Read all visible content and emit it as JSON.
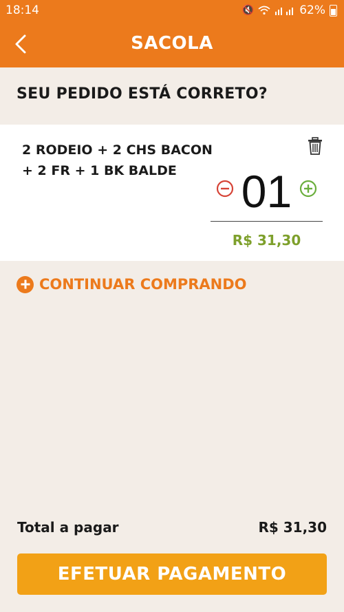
{
  "status_bar": {
    "time": "18:14",
    "battery": "62%"
  },
  "app_bar": {
    "title": "SACOLA"
  },
  "question": "SEU PEDIDO ESTÁ CORRETO?",
  "item": {
    "name_line1": "2 RODEIO + 2 CHS BACON",
    "name_line2": "+ 2 FR + 1 BK BALDE",
    "quantity": "01",
    "price": "R$ 31,30"
  },
  "continue_label": "CONTINUAR COMPRANDO",
  "total": {
    "label": "Total a pagar",
    "value": "R$ 31,30"
  },
  "pay_button_label": "EFETUAR PAGAMENTO",
  "colors": {
    "brand_orange": "#ec7a1c",
    "button_yellow": "#f2a116",
    "price_green": "#7ea02c",
    "minus_red": "#d64336",
    "plus_green": "#6aae3c",
    "background": "#f3ede7"
  },
  "icons": {
    "back": "chevron-left-icon",
    "trash": "trash-icon",
    "minus": "minus-circle-icon",
    "plus": "plus-circle-icon",
    "continue": "plus-circle-filled-icon"
  }
}
